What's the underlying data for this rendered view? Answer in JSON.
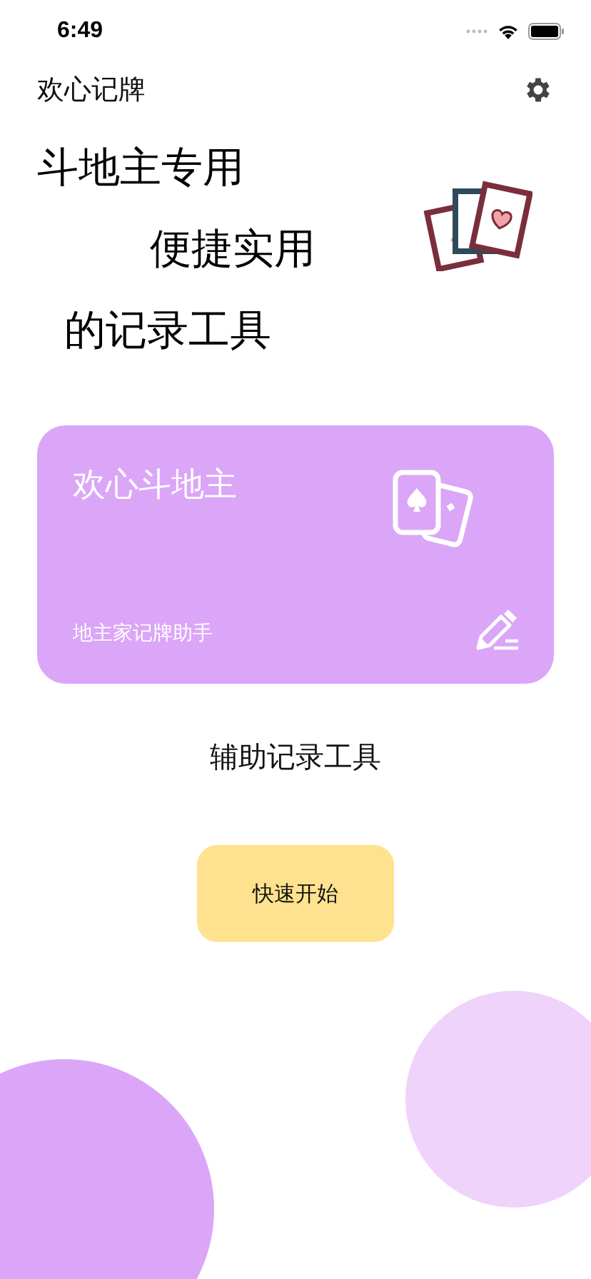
{
  "status_bar": {
    "time": "6:49"
  },
  "header": {
    "title": "欢心记牌"
  },
  "headline": [
    "斗地主专用",
    "便捷实用",
    "的记录工具"
  ],
  "card": {
    "title": "欢心斗地主",
    "subtitle": "地主家记牌助手"
  },
  "caption": "辅助记录工具",
  "start_button": {
    "label": "快速开始"
  }
}
